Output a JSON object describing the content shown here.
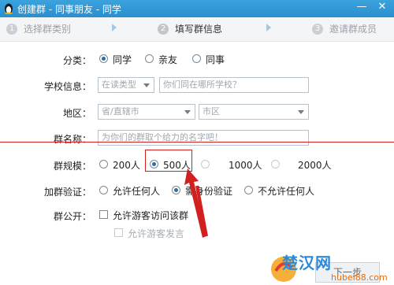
{
  "window": {
    "title": "创建群 - 同事朋友 - 同学",
    "minimize_label": "—",
    "close_label": "✕"
  },
  "steps": [
    {
      "num": "1",
      "label": "选择群类别"
    },
    {
      "num": "2",
      "label": "填写群信息"
    },
    {
      "num": "3",
      "label": "邀请群成员"
    }
  ],
  "form": {
    "category": {
      "label": "分类：",
      "options": [
        "同学",
        "亲友",
        "同事"
      ],
      "selected": "同学"
    },
    "school": {
      "label": "学校信息：",
      "type_placeholder": "在读类型",
      "name_placeholder": "你们同在哪所学校？"
    },
    "region": {
      "label": "地区：",
      "province_placeholder": "省/直辖市",
      "city_placeholder": "市区"
    },
    "group_name": {
      "label": "群名称：",
      "placeholder": "为你们的群取个给力的名字吧！"
    },
    "size": {
      "label": "群规模：",
      "options": [
        "200人",
        "500人",
        "1000人",
        "2000人"
      ],
      "selected": "500人"
    },
    "verify": {
      "label": "加群验证：",
      "options": [
        "允许任何人",
        "需身份验证",
        "不允许任何人"
      ],
      "selected": "需身份验证"
    },
    "public": {
      "label": "群公开：",
      "visitor_access": "允许游客访问该群",
      "visitor_speak": "允许游客发言"
    }
  },
  "footer": {
    "next_label": "下一步"
  },
  "watermark": {
    "name": "楚汉网",
    "url": "hubei88.com"
  },
  "colors": {
    "titlebar": "#2a8fcf",
    "annotation": "#d21f1f",
    "radio_selected": "#2b6fa8"
  }
}
